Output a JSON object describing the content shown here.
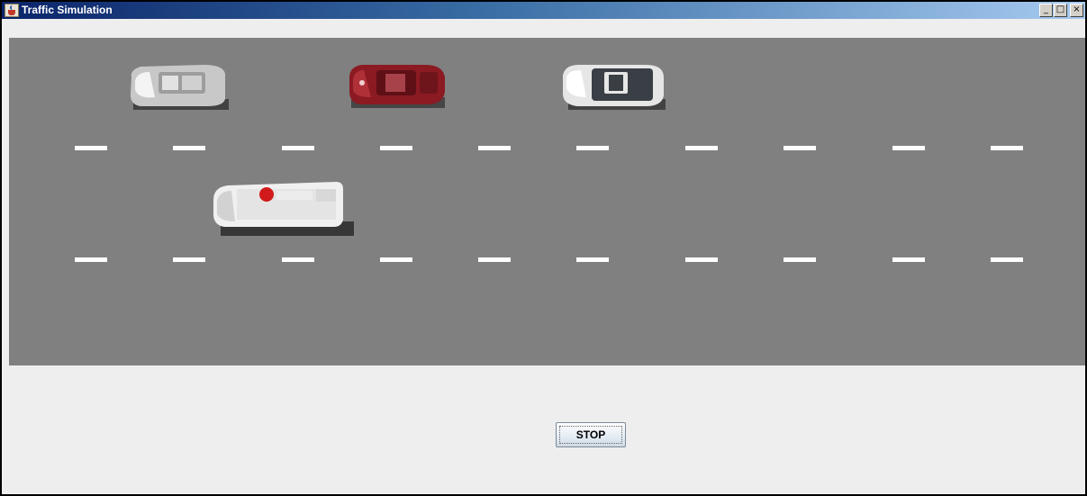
{
  "window": {
    "title": "Traffic Simulation",
    "controls": {
      "minimize": "_",
      "maximize": "□",
      "close": "×"
    }
  },
  "colors": {
    "road": "#808080",
    "lane_marking": "#ffffff",
    "panel": "#eeeeee",
    "title_gradient_start": "#0a246a",
    "title_gradient_end": "#a6caf0"
  },
  "icons": {
    "app": "java-cup-icon",
    "minimize": "minimize-icon",
    "maximize": "maximize-icon",
    "close": "close-icon"
  },
  "vehicles": [
    {
      "name": "silver-car",
      "color": "#c8c8c8"
    },
    {
      "name": "red-car",
      "color": "#8b1a22"
    },
    {
      "name": "white-car",
      "color": "#e6e6e6"
    },
    {
      "name": "ambulance",
      "color": "#f0f0f0"
    }
  ],
  "controls": {
    "stop_label": "STOP"
  }
}
